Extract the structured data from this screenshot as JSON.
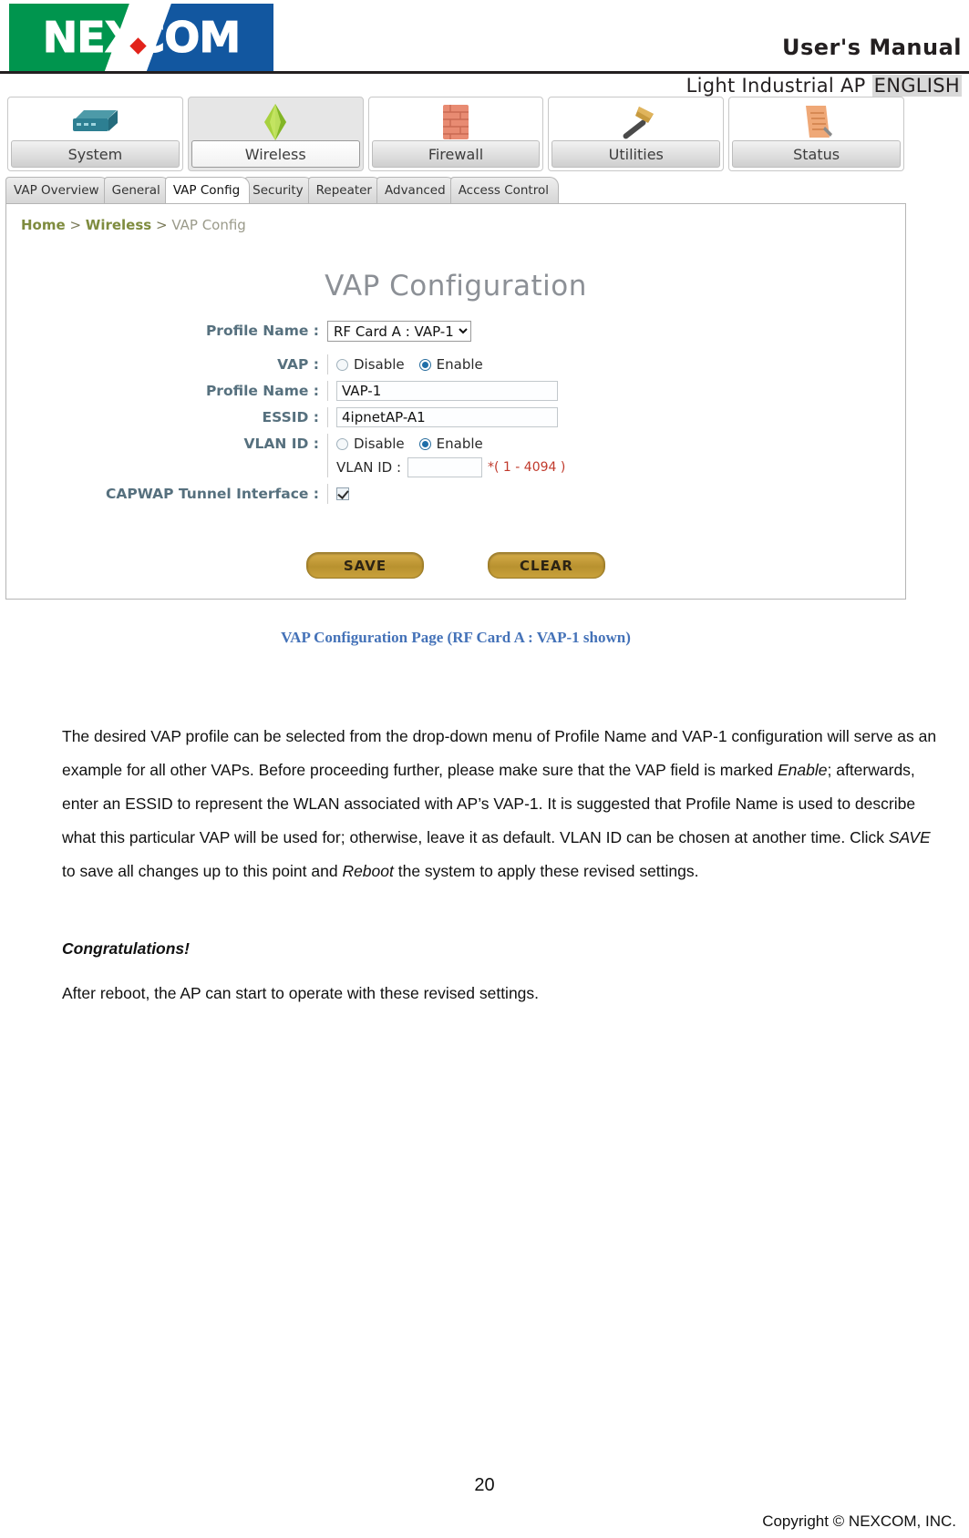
{
  "header": {
    "logo_text": "NEXCOM",
    "title": "User's Manual",
    "subtitle_prefix": "Light Industrial AP ",
    "subtitle_highlight": "ENGLISH"
  },
  "ui": {
    "main_nav": [
      {
        "label": "System",
        "icon": "router-icon",
        "active": false
      },
      {
        "label": "Wireless",
        "icon": "antenna-icon",
        "active": true
      },
      {
        "label": "Firewall",
        "icon": "brick-wall-icon",
        "active": false
      },
      {
        "label": "Utilities",
        "icon": "hammer-icon",
        "active": false
      },
      {
        "label": "Status",
        "icon": "document-icon",
        "active": false
      }
    ],
    "sub_tabs": [
      {
        "label": "VAP Overview",
        "active": false
      },
      {
        "label": "General",
        "active": false
      },
      {
        "label": "VAP Config",
        "active": true
      },
      {
        "label": "Security",
        "active": false
      },
      {
        "label": "Repeater",
        "active": false
      },
      {
        "label": "Advanced",
        "active": false
      },
      {
        "label": "Access Control",
        "active": false
      }
    ],
    "breadcrumb": {
      "home": "Home",
      "sep1": " > ",
      "section": "Wireless",
      "sep2": " > ",
      "current": "VAP Config"
    },
    "form_title": "VAP Configuration",
    "fields": {
      "profile_select_label": "Profile Name :",
      "profile_select_value": "RF Card A : VAP-1",
      "profile_select_options": [
        "RF Card A : VAP-1"
      ],
      "vap_label": "VAP :",
      "vap_disable": "Disable",
      "vap_enable": "Enable",
      "vap_selected": "Enable",
      "profile_name_label": "Profile Name :",
      "profile_name_value": "VAP-1",
      "essid_label": "ESSID :",
      "essid_value": "4ipnetAP-A1",
      "vlan_label": "VLAN ID :",
      "vlan_disable": "Disable",
      "vlan_enable": "Enable",
      "vlan_selected": "Enable",
      "vlan_id_sub_label": "VLAN ID :",
      "vlan_id_value": "",
      "vlan_id_hint": "*( 1 - 4094 )",
      "capwap_label": "CAPWAP Tunnel Interface :",
      "capwap_checked": true
    },
    "buttons": {
      "save": "SAVE",
      "clear": "CLEAR"
    },
    "accent_color": "#c9a23c"
  },
  "caption": "VAP Configuration Page (RF Card A : VAP-1 shown)",
  "body": {
    "paragraph_1": "The desired VAP profile can be selected from the drop-down menu of Profile Name and VAP-1 configuration will serve as an example for all other VAPs. Before proceeding further, please make sure that the VAP field is marked ",
    "paragraph_1_em1": "Enable",
    "paragraph_1_b": "; afterwards, enter an ESSID to represent the WLAN associated with AP’s VAP-1. It is suggested that Profile Name is used to describe what this particular VAP will be used for; otherwise, leave it as default. VLAN ID can be chosen at another time. Click ",
    "paragraph_1_em2": "SAVE",
    "paragraph_1_c": " to save all changes up to this point and ",
    "paragraph_1_em3": "Reboot",
    "paragraph_1_d": " the system to apply these revised settings.",
    "congrats_heading": "Congratulations!",
    "paragraph_2": "After reboot, the AP can start to operate with these revised settings."
  },
  "footer": {
    "page_number": "20",
    "copyright": "Copyright © NEXCOM, INC."
  }
}
